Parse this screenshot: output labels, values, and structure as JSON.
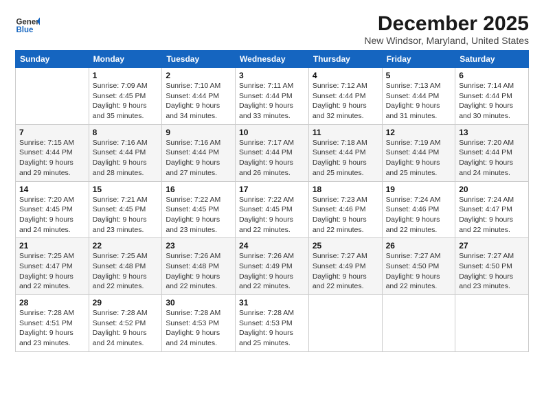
{
  "logo": {
    "text_general": "General",
    "text_blue": "Blue"
  },
  "title": "December 2025",
  "subtitle": "New Windsor, Maryland, United States",
  "days_header": [
    "Sunday",
    "Monday",
    "Tuesday",
    "Wednesday",
    "Thursday",
    "Friday",
    "Saturday"
  ],
  "weeks": [
    [
      {
        "day": "",
        "sunrise": "",
        "sunset": "",
        "daylight": ""
      },
      {
        "day": "1",
        "sunrise": "Sunrise: 7:09 AM",
        "sunset": "Sunset: 4:45 PM",
        "daylight": "Daylight: 9 hours and 35 minutes."
      },
      {
        "day": "2",
        "sunrise": "Sunrise: 7:10 AM",
        "sunset": "Sunset: 4:44 PM",
        "daylight": "Daylight: 9 hours and 34 minutes."
      },
      {
        "day": "3",
        "sunrise": "Sunrise: 7:11 AM",
        "sunset": "Sunset: 4:44 PM",
        "daylight": "Daylight: 9 hours and 33 minutes."
      },
      {
        "day": "4",
        "sunrise": "Sunrise: 7:12 AM",
        "sunset": "Sunset: 4:44 PM",
        "daylight": "Daylight: 9 hours and 32 minutes."
      },
      {
        "day": "5",
        "sunrise": "Sunrise: 7:13 AM",
        "sunset": "Sunset: 4:44 PM",
        "daylight": "Daylight: 9 hours and 31 minutes."
      },
      {
        "day": "6",
        "sunrise": "Sunrise: 7:14 AM",
        "sunset": "Sunset: 4:44 PM",
        "daylight": "Daylight: 9 hours and 30 minutes."
      }
    ],
    [
      {
        "day": "7",
        "sunrise": "Sunrise: 7:15 AM",
        "sunset": "Sunset: 4:44 PM",
        "daylight": "Daylight: 9 hours and 29 minutes."
      },
      {
        "day": "8",
        "sunrise": "Sunrise: 7:16 AM",
        "sunset": "Sunset: 4:44 PM",
        "daylight": "Daylight: 9 hours and 28 minutes."
      },
      {
        "day": "9",
        "sunrise": "Sunrise: 7:16 AM",
        "sunset": "Sunset: 4:44 PM",
        "daylight": "Daylight: 9 hours and 27 minutes."
      },
      {
        "day": "10",
        "sunrise": "Sunrise: 7:17 AM",
        "sunset": "Sunset: 4:44 PM",
        "daylight": "Daylight: 9 hours and 26 minutes."
      },
      {
        "day": "11",
        "sunrise": "Sunrise: 7:18 AM",
        "sunset": "Sunset: 4:44 PM",
        "daylight": "Daylight: 9 hours and 25 minutes."
      },
      {
        "day": "12",
        "sunrise": "Sunrise: 7:19 AM",
        "sunset": "Sunset: 4:44 PM",
        "daylight": "Daylight: 9 hours and 25 minutes."
      },
      {
        "day": "13",
        "sunrise": "Sunrise: 7:20 AM",
        "sunset": "Sunset: 4:44 PM",
        "daylight": "Daylight: 9 hours and 24 minutes."
      }
    ],
    [
      {
        "day": "14",
        "sunrise": "Sunrise: 7:20 AM",
        "sunset": "Sunset: 4:45 PM",
        "daylight": "Daylight: 9 hours and 24 minutes."
      },
      {
        "day": "15",
        "sunrise": "Sunrise: 7:21 AM",
        "sunset": "Sunset: 4:45 PM",
        "daylight": "Daylight: 9 hours and 23 minutes."
      },
      {
        "day": "16",
        "sunrise": "Sunrise: 7:22 AM",
        "sunset": "Sunset: 4:45 PM",
        "daylight": "Daylight: 9 hours and 23 minutes."
      },
      {
        "day": "17",
        "sunrise": "Sunrise: 7:22 AM",
        "sunset": "Sunset: 4:45 PM",
        "daylight": "Daylight: 9 hours and 22 minutes."
      },
      {
        "day": "18",
        "sunrise": "Sunrise: 7:23 AM",
        "sunset": "Sunset: 4:46 PM",
        "daylight": "Daylight: 9 hours and 22 minutes."
      },
      {
        "day": "19",
        "sunrise": "Sunrise: 7:24 AM",
        "sunset": "Sunset: 4:46 PM",
        "daylight": "Daylight: 9 hours and 22 minutes."
      },
      {
        "day": "20",
        "sunrise": "Sunrise: 7:24 AM",
        "sunset": "Sunset: 4:47 PM",
        "daylight": "Daylight: 9 hours and 22 minutes."
      }
    ],
    [
      {
        "day": "21",
        "sunrise": "Sunrise: 7:25 AM",
        "sunset": "Sunset: 4:47 PM",
        "daylight": "Daylight: 9 hours and 22 minutes."
      },
      {
        "day": "22",
        "sunrise": "Sunrise: 7:25 AM",
        "sunset": "Sunset: 4:48 PM",
        "daylight": "Daylight: 9 hours and 22 minutes."
      },
      {
        "day": "23",
        "sunrise": "Sunrise: 7:26 AM",
        "sunset": "Sunset: 4:48 PM",
        "daylight": "Daylight: 9 hours and 22 minutes."
      },
      {
        "day": "24",
        "sunrise": "Sunrise: 7:26 AM",
        "sunset": "Sunset: 4:49 PM",
        "daylight": "Daylight: 9 hours and 22 minutes."
      },
      {
        "day": "25",
        "sunrise": "Sunrise: 7:27 AM",
        "sunset": "Sunset: 4:49 PM",
        "daylight": "Daylight: 9 hours and 22 minutes."
      },
      {
        "day": "26",
        "sunrise": "Sunrise: 7:27 AM",
        "sunset": "Sunset: 4:50 PM",
        "daylight": "Daylight: 9 hours and 22 minutes."
      },
      {
        "day": "27",
        "sunrise": "Sunrise: 7:27 AM",
        "sunset": "Sunset: 4:50 PM",
        "daylight": "Daylight: 9 hours and 23 minutes."
      }
    ],
    [
      {
        "day": "28",
        "sunrise": "Sunrise: 7:28 AM",
        "sunset": "Sunset: 4:51 PM",
        "daylight": "Daylight: 9 hours and 23 minutes."
      },
      {
        "day": "29",
        "sunrise": "Sunrise: 7:28 AM",
        "sunset": "Sunset: 4:52 PM",
        "daylight": "Daylight: 9 hours and 24 minutes."
      },
      {
        "day": "30",
        "sunrise": "Sunrise: 7:28 AM",
        "sunset": "Sunset: 4:53 PM",
        "daylight": "Daylight: 9 hours and 24 minutes."
      },
      {
        "day": "31",
        "sunrise": "Sunrise: 7:28 AM",
        "sunset": "Sunset: 4:53 PM",
        "daylight": "Daylight: 9 hours and 25 minutes."
      },
      {
        "day": "",
        "sunrise": "",
        "sunset": "",
        "daylight": ""
      },
      {
        "day": "",
        "sunrise": "",
        "sunset": "",
        "daylight": ""
      },
      {
        "day": "",
        "sunrise": "",
        "sunset": "",
        "daylight": ""
      }
    ]
  ]
}
